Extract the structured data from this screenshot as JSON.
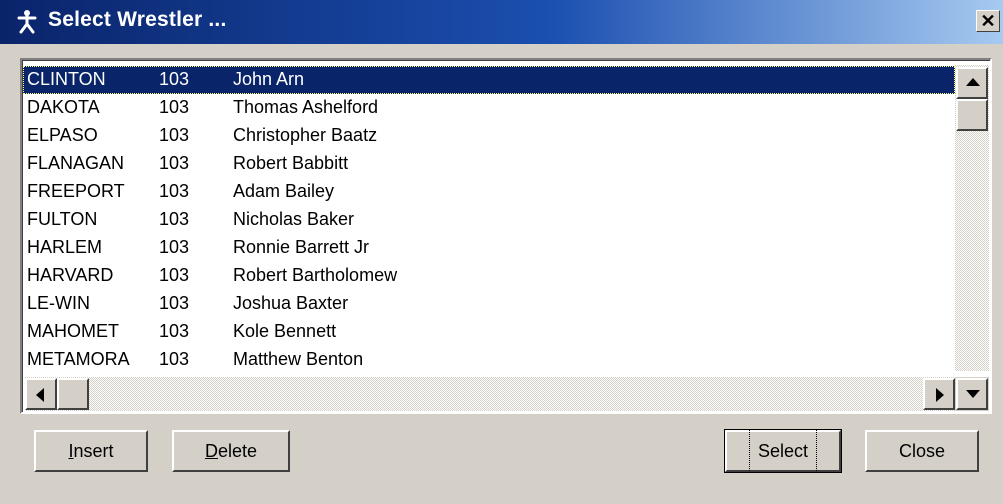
{
  "window": {
    "title": "Select Wrestler ...",
    "title_icon": "stick-figure-icon",
    "close_icon": "close-icon",
    "colors": {
      "titlebar_start": "#0a246a",
      "titlebar_end": "#a6caf0",
      "selection": "#0a246a",
      "face": "#d4d0c8"
    }
  },
  "list": {
    "selected_index": 0,
    "rows": [
      {
        "team": "CLINTON",
        "weight": "103",
        "name": "John Arn"
      },
      {
        "team": "DAKOTA",
        "weight": "103",
        "name": "Thomas Ashelford"
      },
      {
        "team": "ELPASO",
        "weight": "103",
        "name": "Christopher Baatz"
      },
      {
        "team": "FLANAGAN",
        "weight": "103",
        "name": "Robert Babbitt"
      },
      {
        "team": "FREEPORT",
        "weight": "103",
        "name": "Adam Bailey"
      },
      {
        "team": "FULTON",
        "weight": "103",
        "name": "Nicholas Baker"
      },
      {
        "team": "HARLEM",
        "weight": "103",
        "name": "Ronnie Barrett     Jr"
      },
      {
        "team": "HARVARD",
        "weight": "103",
        "name": "Robert Bartholomew"
      },
      {
        "team": "LE-WIN",
        "weight": "103",
        "name": "Joshua Baxter"
      },
      {
        "team": "MAHOMET",
        "weight": "103",
        "name": "Kole Bennett"
      },
      {
        "team": "METAMORA",
        "weight": "103",
        "name": "Matthew Benton"
      }
    ]
  },
  "buttons": {
    "insert": {
      "label_ul": "I",
      "label_rest": "nsert"
    },
    "delete": {
      "label_ul": "D",
      "label_rest": "elete"
    },
    "select": {
      "label_ul": "S",
      "label_rest": "elect"
    },
    "close": {
      "label": "Close"
    }
  }
}
